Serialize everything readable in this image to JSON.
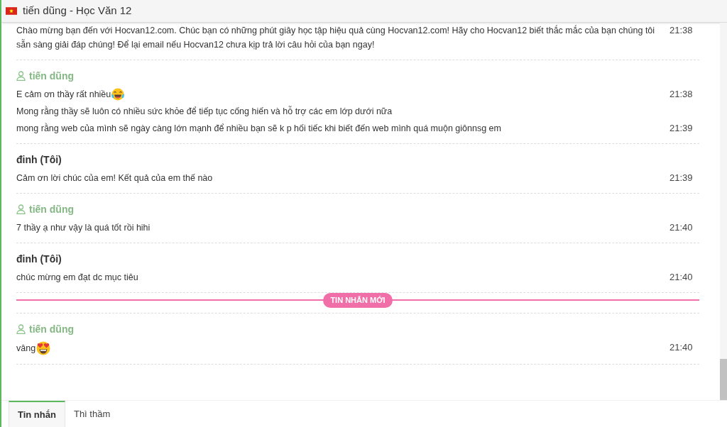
{
  "window": {
    "title": "tiến dũng - Học Văn 12"
  },
  "messages": [
    {
      "kind": "message",
      "lines": [
        {
          "kind": "plain",
          "text": "Chào mừng bạn đến với Hocvan12.com. Chúc bạn có những phút giây học tập hiệu quả cùng Hocvan12.com! Hãy cho Hocvan12 biết thắc mắc của bạn chúng tôi sẵn sàng giải đáp chúng! Để lại email nếu Hocvan12 chưa kịp trả lời câu hỏi của bạn ngay!",
          "time": "21:38"
        }
      ]
    },
    {
      "kind": "message",
      "sender": {
        "name": "tiến dũng",
        "kind": "guest"
      },
      "lines": [
        {
          "kind": "tears-of-joy",
          "text": "E cảm ơn thầy rất nhiều",
          "time": "21:38"
        },
        {
          "kind": "plain",
          "text": "Mong rằng thầy sẽ luôn có nhiều sức khỏe để tiếp tục cống hiến và hỗ trợ các em lớp dưới nữa"
        },
        {
          "kind": "plain",
          "text": "mong rằng web của mình sẽ ngày càng lớn mạnh để nhiều bạn sẽ k p hối tiếc khi biết đến web mình quá muộn giônnsg em",
          "time": "21:39"
        }
      ]
    },
    {
      "kind": "message",
      "sender": {
        "name": "đinh (Tôi)",
        "kind": "self"
      },
      "lines": [
        {
          "kind": "plain",
          "text": "Cảm ơn lời chúc của em! Kết quả của em thế nào",
          "time": "21:39"
        }
      ]
    },
    {
      "kind": "message",
      "sender": {
        "name": "tiến dũng",
        "kind": "guest"
      },
      "lines": [
        {
          "kind": "plain",
          "text": "7 thầy ạ như vậy là quá tốt rồi hihi",
          "time": "21:40"
        }
      ]
    },
    {
      "kind": "message",
      "sender": {
        "name": "đinh (Tôi)",
        "kind": "self"
      },
      "lines": [
        {
          "kind": "plain",
          "text": "chúc mừng em đạt dc mục tiêu",
          "time": "21:40"
        }
      ]
    },
    {
      "kind": "new-divider",
      "label": "TIN NHẮN MỚI"
    },
    {
      "kind": "message",
      "sender": {
        "name": "tiến dũng",
        "kind": "guest"
      },
      "lines": [
        {
          "kind": "heart-eyes",
          "text": "vâng",
          "time": "21:40"
        }
      ]
    }
  ],
  "tabs": [
    {
      "label": "Tin nhắn",
      "selected": true
    },
    {
      "label": "Thì thầm",
      "selected": false
    }
  ]
}
